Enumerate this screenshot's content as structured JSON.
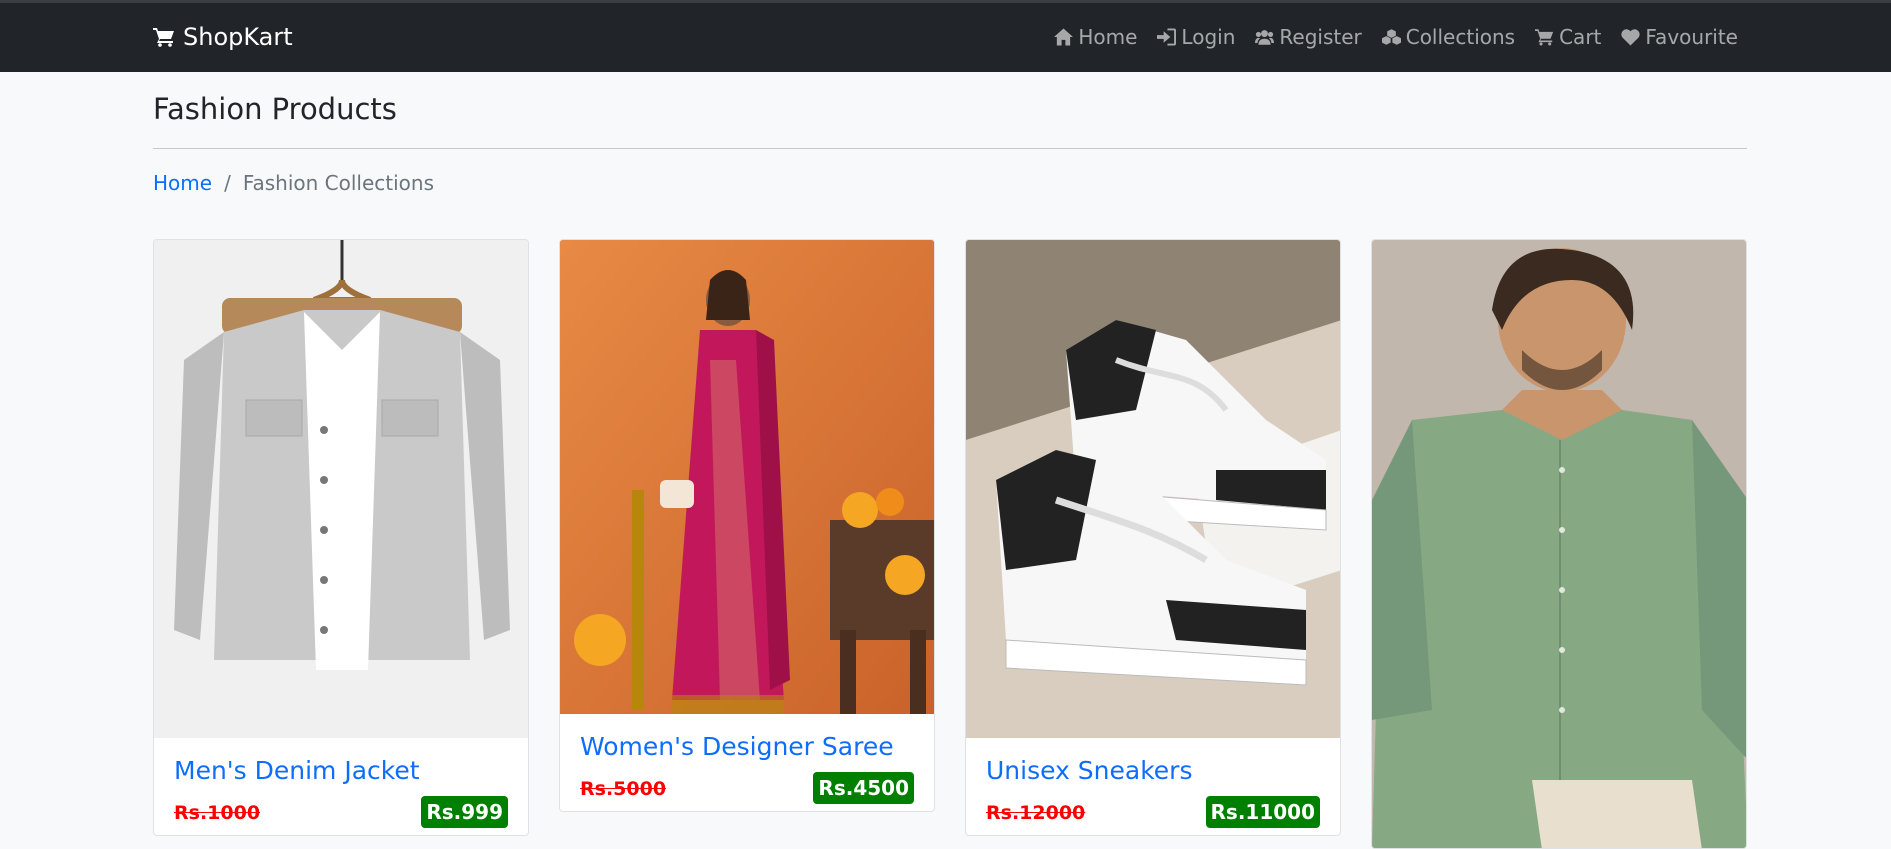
{
  "navbar": {
    "brand": "ShopKart",
    "links": [
      {
        "label": "Home",
        "icon": "home-icon"
      },
      {
        "label": "Login",
        "icon": "sign-in-icon"
      },
      {
        "label": "Register",
        "icon": "users-icon"
      },
      {
        "label": "Collections",
        "icon": "cubes-icon"
      },
      {
        "label": "Cart",
        "icon": "cart-icon"
      },
      {
        "label": "Favourite",
        "icon": "heart-icon"
      }
    ]
  },
  "page": {
    "title": "Fashion Products"
  },
  "breadcrumb": {
    "home": "Home",
    "separator": "/",
    "current": "Fashion Collections"
  },
  "products": [
    {
      "name": "Men's Denim Jacket",
      "original_price": "Rs.1000",
      "price": "Rs.999"
    },
    {
      "name": "Women's Designer Saree",
      "original_price": "Rs.5000",
      "price": "Rs.4500"
    },
    {
      "name": "Unisex Sneakers",
      "original_price": "Rs.12000",
      "price": "Rs.11000"
    },
    {
      "name": "",
      "original_price": "",
      "price": ""
    }
  ],
  "colors": {
    "navbar_bg": "#212529",
    "link": "#0d6efd",
    "old_price": "#ff0000",
    "price_badge": "#008000"
  }
}
